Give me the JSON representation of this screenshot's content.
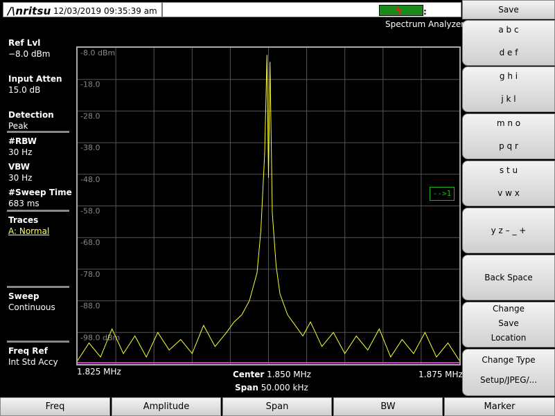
{
  "header": {
    "brand": "/\\nritsu",
    "datetime": "12/03/2019 09:35:39 am",
    "mode": "Spectrum Analyzer",
    "battery_color": "#1a8a1a"
  },
  "params": {
    "ref_lvl_label": "Ref Lvl",
    "ref_lvl_value": "−8.0 dBm",
    "input_atten_label": "Input Atten",
    "input_atten_value": "15.0 dB",
    "detection_label": "Detection",
    "detection_value": "Peak",
    "rbw_label": "#RBW",
    "rbw_value": "30 Hz",
    "vbw_label": "VBW",
    "vbw_value": "30 Hz",
    "sweep_time_label": "#Sweep Time",
    "sweep_time_value": "683 ms",
    "traces_label": "Traces",
    "traces_value": "A: Normal",
    "sweep_label": "Sweep",
    "sweep_value": "Continuous",
    "freq_ref_label": "Freq Ref",
    "freq_ref_value": "Int Std Accy"
  },
  "graph": {
    "y_labels": [
      "-8.0 dBm",
      "-18.0",
      "-28.0",
      "-38.0",
      "-48.0",
      "-58.0",
      "-68.0",
      "-78.0",
      "-88.0",
      "-98.0 dBm"
    ],
    "start_freq": "1.825 MHz",
    "stop_freq": "1.875 MHz",
    "center_label": "Center",
    "center_value": "1.850 MHz",
    "span_label": "Span",
    "span_value": "50.000 kHz",
    "marker_ref": "-->1",
    "trace_color": "#ffff33",
    "grid_color": "#555555"
  },
  "chart_data": {
    "type": "line",
    "title": "",
    "xlabel": "",
    "ylabel": "",
    "xlim": [
      1.825,
      1.875
    ],
    "ylim": [
      -98.0,
      -8.0
    ],
    "x_unit": "MHz",
    "y_unit": "dBm",
    "series": [
      {
        "x": [
          1.825,
          1.8265,
          1.828,
          1.8295,
          1.831,
          1.8325,
          1.834,
          1.8355,
          1.837,
          1.8385,
          1.84,
          1.8415,
          1.843,
          1.8445,
          1.8455,
          1.8465,
          1.8475,
          1.8485,
          1.849,
          1.8495,
          1.8498,
          1.85,
          1.8502,
          1.8505,
          1.851,
          1.8515,
          1.8525,
          1.8535,
          1.8545,
          1.8555,
          1.857,
          1.8585,
          1.86,
          1.8615,
          1.863,
          1.8645,
          1.866,
          1.8675,
          1.869,
          1.8705,
          1.872,
          1.8735,
          1.875
        ],
        "values": [
          -97,
          -92,
          -96,
          -88,
          -95,
          -90,
          -96,
          -89,
          -94,
          -91,
          -95,
          -87,
          -93,
          -89,
          -86,
          -84,
          -80,
          -72,
          -60,
          -38,
          -10,
          -45,
          -12,
          -55,
          -70,
          -78,
          -84,
          -87,
          -90,
          -86,
          -93,
          -89,
          -95,
          -90,
          -94,
          -88,
          -96,
          -91,
          -95,
          -89,
          -96,
          -92,
          -97
        ]
      }
    ],
    "grid": true
  },
  "softkeys": {
    "title": "Save",
    "k1": [
      "a b c",
      "d e f"
    ],
    "k2": [
      "g h i",
      "j k l"
    ],
    "k3": [
      "m n o",
      "p q r"
    ],
    "k4": [
      "s t u",
      "v w x"
    ],
    "k5": "y z – _ +",
    "k6": "Back Space",
    "k7": [
      "Change",
      "Save",
      "Location"
    ],
    "k8": [
      "Change Type",
      "Setup/JPEG/..."
    ]
  },
  "bottom_menu": [
    "Freq",
    "Amplitude",
    "Span",
    "BW",
    "Marker"
  ]
}
